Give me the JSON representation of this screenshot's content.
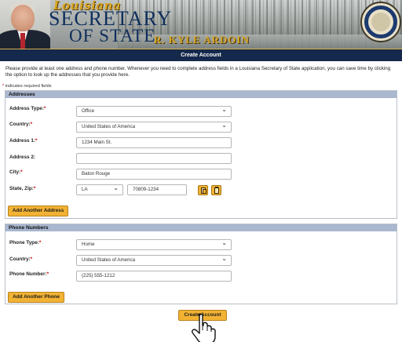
{
  "header": {
    "state_script": "Louisiana",
    "title_line1": "SECRETARY",
    "title_line2": "OF STATE",
    "official_name": "R. KYLE ARDOIN",
    "seal_text": "STATE OF LOUISIANA · DEPARTMENT OF STATE"
  },
  "page": {
    "title": "Create Account",
    "intro": "Please provide at least one address and phone number. Whenever you need to complete address fields in a Louisiana Secretary of State application, you can save time by clicking the option to look up the addresses that you provide here.",
    "required_note": "indicates required fields",
    "required_star": "*"
  },
  "addresses": {
    "heading": "Addresses",
    "address_type": {
      "label": "Address Type:",
      "value": "Office",
      "required": true
    },
    "country": {
      "label": "Country:",
      "value": "United States of America",
      "required": true
    },
    "address1": {
      "label": "Address 1:",
      "value": "1234 Main St.",
      "required": true
    },
    "address2": {
      "label": "Address 2:",
      "value": "",
      "required": false
    },
    "city": {
      "label": "City:",
      "value": "Baton Rouge",
      "required": true
    },
    "state_zip": {
      "label": "State, Zip:",
      "state": "LA",
      "zip": "70809-1234",
      "required": true
    },
    "add_button": "Add Another Address"
  },
  "phones": {
    "heading": "Phone Numbers",
    "phone_type": {
      "label": "Phone Type:",
      "value": "Home",
      "required": true
    },
    "country": {
      "label": "Country:",
      "value": "United States of America",
      "required": true
    },
    "phone_number": {
      "label": "Phone Number:",
      "value": "(225) 555-1212",
      "required": true
    },
    "add_button": "Add Another Phone"
  },
  "submit_button": "Create Account",
  "icons": {
    "copy": "copy-icon",
    "paste": "clipboard-icon",
    "cursor": "hand-pointer-icon",
    "seal": "state-seal-icon"
  },
  "colors": {
    "header_bar": "#14294b",
    "section_header": "#a9b7cf",
    "button": "#f2b233",
    "required": "#cc0000",
    "title_blue": "#0f2e5c",
    "gold": "#d9a521"
  }
}
